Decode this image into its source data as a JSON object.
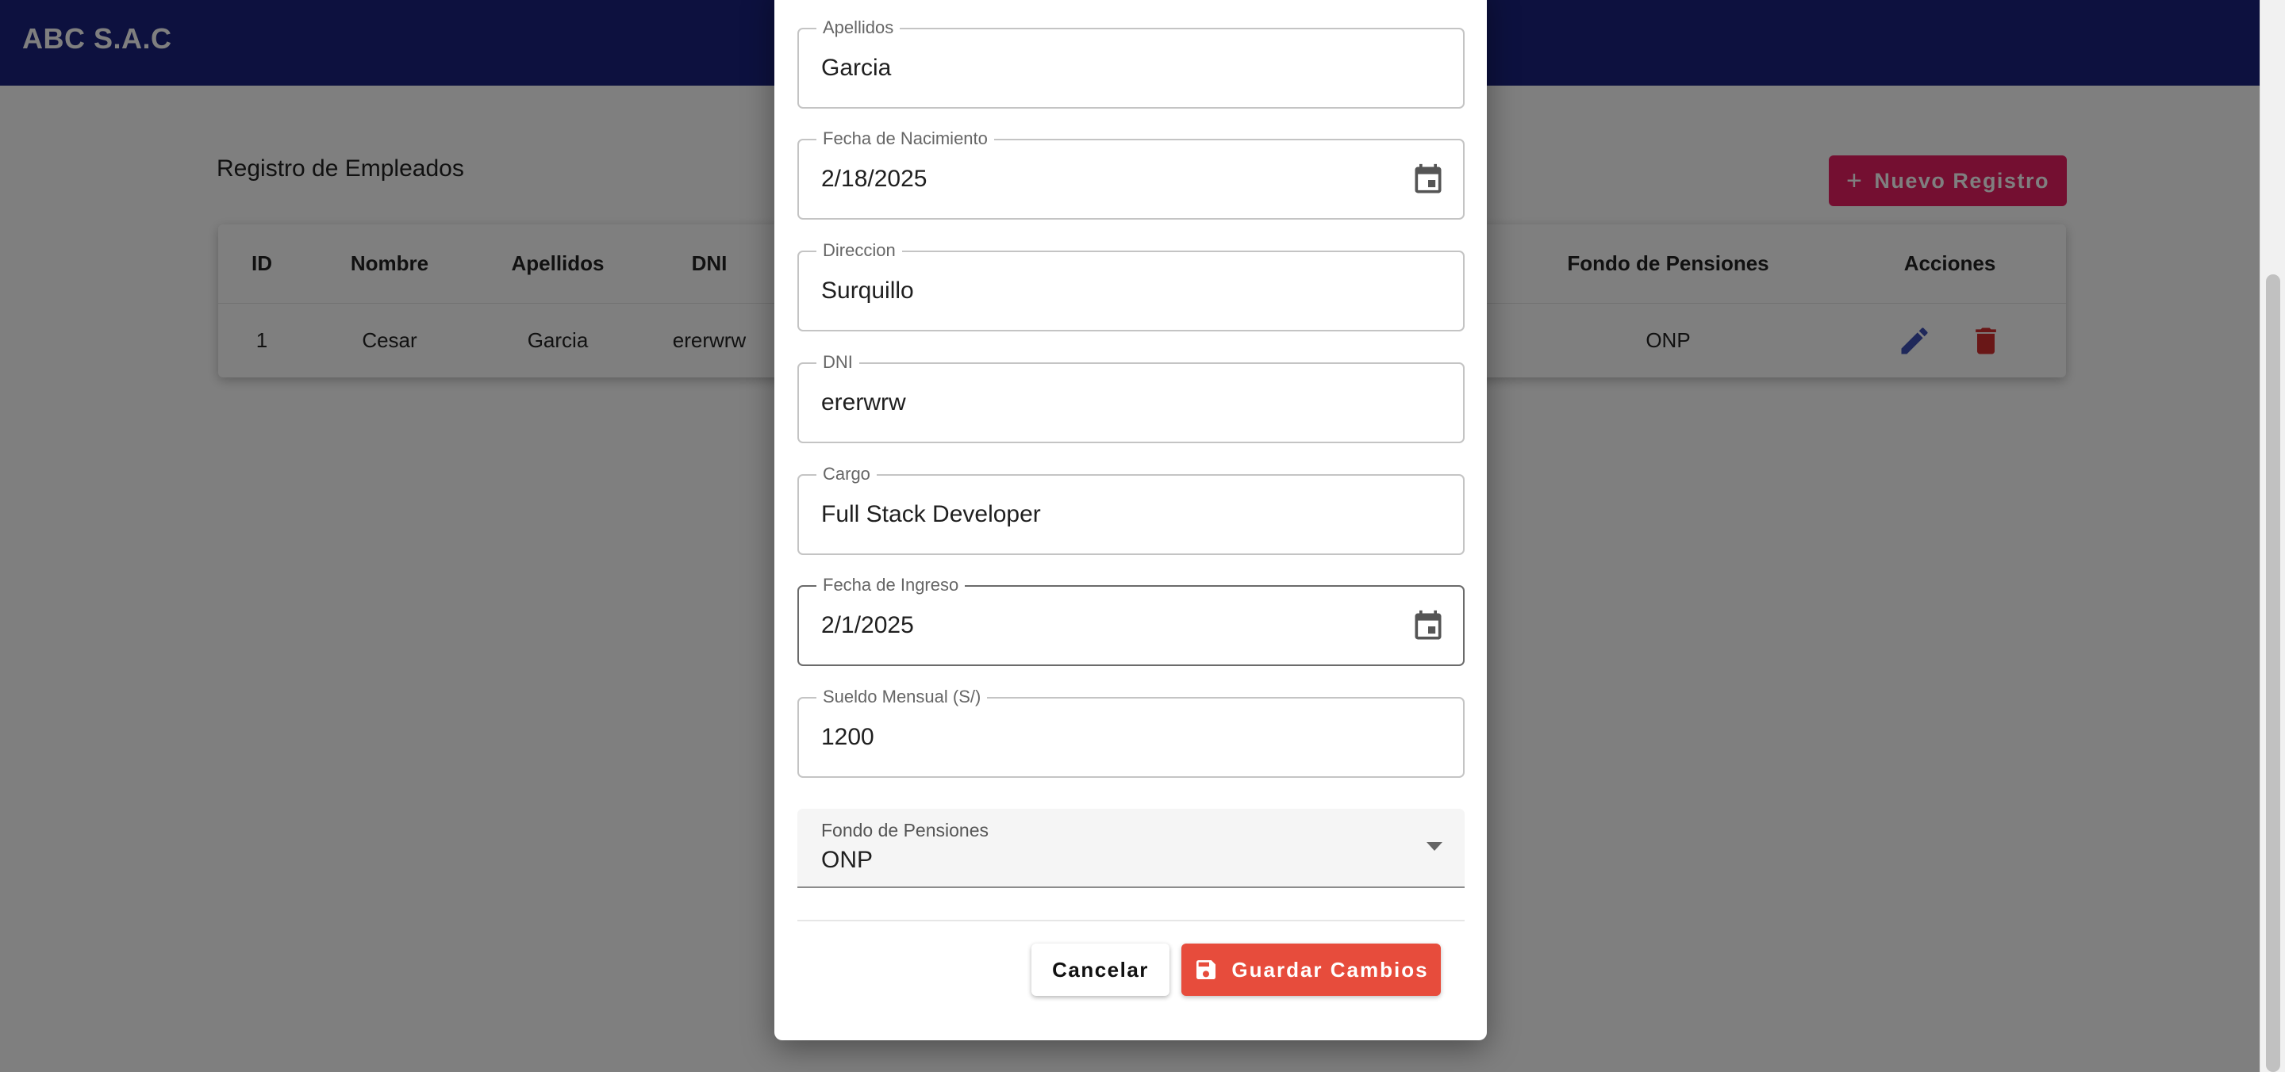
{
  "app": {
    "brand": "ABC S.A.C"
  },
  "page": {
    "title": "Registro de Empleados",
    "new_button_label": "Nuevo Registro"
  },
  "table": {
    "headers": {
      "id": "ID",
      "nombre": "Nombre",
      "apellidos": "Apellidos",
      "dni": "DNI",
      "fondo": "Fondo de Pensiones",
      "acciones": "Acciones"
    },
    "rows": [
      {
        "id": "1",
        "nombre": "Cesar",
        "apellidos": "Garcia",
        "dni": "ererwrw",
        "fondo": "ONP"
      }
    ]
  },
  "dialog": {
    "fields": {
      "apellidos": {
        "label": "Apellidos",
        "value": "Garcia"
      },
      "fecha_nacimiento": {
        "label": "Fecha de Nacimiento",
        "value": "2/18/2025"
      },
      "direccion": {
        "label": "Direccion",
        "value": "Surquillo"
      },
      "dni": {
        "label": "DNI",
        "value": "ererwrw"
      },
      "cargo": {
        "label": "Cargo",
        "value": "Full Stack Developer"
      },
      "fecha_ingreso": {
        "label": "Fecha de Ingreso",
        "value": "2/1/2025"
      },
      "sueldo": {
        "label": "Sueldo Mensual (S/)",
        "value": "1200"
      },
      "fondo": {
        "label": "Fondo de Pensiones",
        "value": "ONP"
      }
    },
    "cancel_label": "Cancelar",
    "save_label": "Guardar Cambios"
  },
  "icons": {
    "calendar": "calendar-icon",
    "edit": "edit-icon",
    "delete": "delete-icon",
    "save": "save-icon",
    "plus": "plus-icon",
    "dropdown": "chevron-down-icon"
  },
  "colors": {
    "appbar": "#1a237e",
    "new_button": "#e91e63",
    "save_button": "#e74c3c",
    "edit_icon": "#3f51b5",
    "delete_icon": "#d32f2f"
  }
}
